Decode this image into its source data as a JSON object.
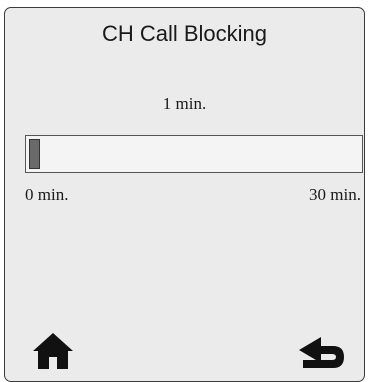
{
  "screen": {
    "title": "CH Call Blocking"
  },
  "slider": {
    "current_value": "1 min.",
    "min_label": "0 min.",
    "max_label": "30 min.",
    "min": 0,
    "max": 30,
    "value": 1
  },
  "icons": {
    "home": "home-icon",
    "back": "return-arrow-icon"
  },
  "colors": {
    "background": "#ebebeb",
    "border": "#3a3a3a",
    "bar_fill": "#6a6a6a",
    "icon": "#111111"
  }
}
